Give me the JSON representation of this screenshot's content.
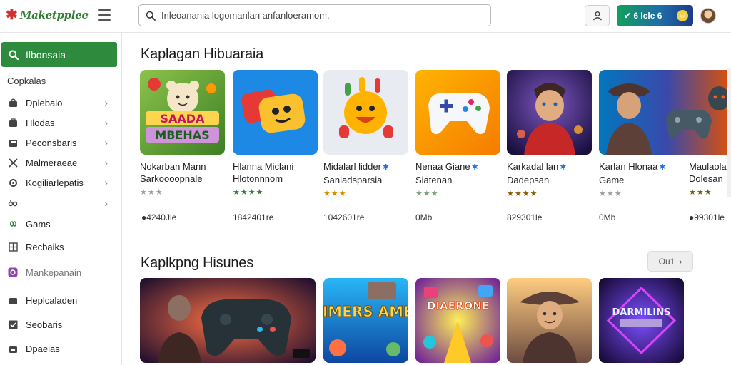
{
  "header": {
    "brand_mark": "✱",
    "brand_name": "Maketpplee",
    "search_placeholder": "Inleoanania logomanlan anfanloeramom.",
    "cta_label": "✔ 6 lcle 6",
    "cta_icon": "coin-icon"
  },
  "sidebar": {
    "active_label": "Ilbonsaia",
    "section_label": "Copkalas",
    "items": [
      {
        "label": "Dplebaio",
        "icon": "bag-icon",
        "chevron": true
      },
      {
        "label": "Hlodas",
        "icon": "bag-icon",
        "chevron": true
      },
      {
        "label": "Peconsbaris",
        "icon": "box-icon",
        "chevron": true
      },
      {
        "label": "Malmeraeae",
        "icon": "tools-icon",
        "chevron": true
      },
      {
        "label": "Kogiliarlepatis",
        "icon": "settings-icon",
        "chevron": true
      },
      {
        "label": "",
        "icon": "link-icon",
        "chevron": true
      },
      {
        "label": "Gams",
        "icon": "infinity-icon",
        "chevron": false
      },
      {
        "label": "Recbaiks",
        "icon": "grid-icon",
        "chevron": false
      },
      {
        "label": "Mankepanain",
        "icon": "purple-app-icon",
        "chevron": false
      },
      {
        "label": "Heplcaladen",
        "icon": "bag-icon",
        "chevron": false
      },
      {
        "label": "Seobaris",
        "icon": "check-icon",
        "chevron": false
      },
      {
        "label": "Dpaelas",
        "icon": "bag-icon",
        "chevron": false
      }
    ]
  },
  "main": {
    "section1_title": "Kaplagan Hibuaraia",
    "section2_title": "Kaplkpng Hisunes",
    "more_label": "Ou1",
    "cards": [
      {
        "title1": "Nokarban Mann",
        "title2": "Sarkoooopnale",
        "badge": false,
        "stars": "★★★",
        "star_color": "#9e9e9e",
        "price": "●4240Jle"
      },
      {
        "title1": "Hlanna Miclani",
        "title2": "Hlotonnnom",
        "badge": false,
        "stars": "★★★★",
        "star_color": "#2e7d32",
        "price": "1842401re"
      },
      {
        "title1": "Midalarl lidder",
        "title2": "Sanladsparsia",
        "badge": true,
        "stars": "★★★",
        "star_color": "#d98c00",
        "price": "1042601re"
      },
      {
        "title1": "Nenaa Giane",
        "title2": "Siatenan",
        "badge": true,
        "stars": "★★★",
        "star_color": "#7aa37a",
        "price": "0Mb"
      },
      {
        "title1": "Karkadal lan",
        "title2": "Dadepsan",
        "badge": true,
        "stars": "★★★★",
        "star_color": "#8a5a00",
        "price": "829301le"
      },
      {
        "title1": "Karlan Hlonaa",
        "title2": "Game",
        "badge": true,
        "stars": "★★★",
        "star_color": "#9e9e9e",
        "price": "0Mb"
      },
      {
        "title1": "Maulaolanl",
        "title2": "Dolesan",
        "badge": false,
        "stars": "★★★",
        "star_color": "#6b5a00",
        "price": "●99301le"
      }
    ],
    "row2_texts": [
      "",
      "MIMERS AMES",
      "DIAERONE",
      "",
      "DARMILINS"
    ]
  }
}
